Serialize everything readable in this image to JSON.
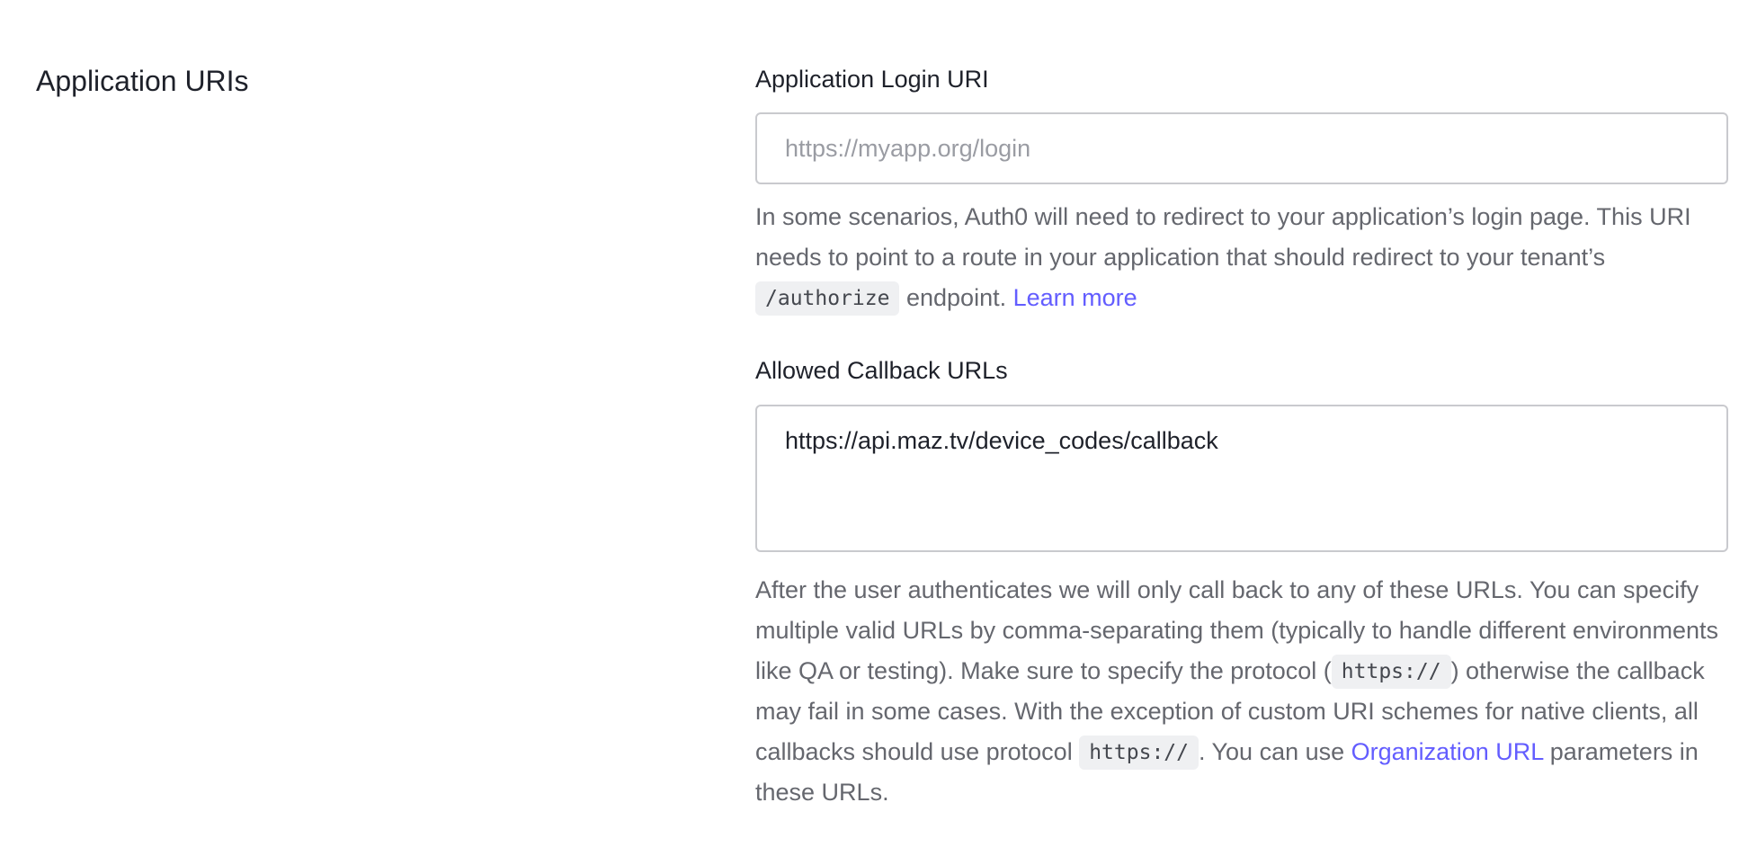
{
  "section": {
    "title": "Application URIs"
  },
  "login_uri": {
    "label": "Application Login URI",
    "value": "",
    "placeholder": "https://myapp.org/login",
    "help_part1": "In some scenarios, Auth0 will need to redirect to your application’s login page. This URI needs to point to a route in your application that should redirect to your tenant’s ",
    "help_code": "/authorize",
    "help_part2": " endpoint. ",
    "help_link": "Learn more"
  },
  "callback_urls": {
    "label": "Allowed Callback URLs",
    "value": "https://api.maz.tv/device_codes/callback",
    "help_part1": "After the user authenticates we will only call back to any of these URLs. You can specify multiple valid URLs by comma-separating them (typically to handle different environments like QA or testing). Make sure to specify the protocol (",
    "help_code1": "https://",
    "help_part2": ") otherwise the callback may fail in some cases. With the exception of custom URI schemes for native clients, all callbacks should use protocol ",
    "help_code2": "https://",
    "help_part3": ". You can use ",
    "help_link": "Organization URL",
    "help_part4": " parameters in these URLs."
  },
  "colors": {
    "link": "#635dff",
    "text": "#1e212a",
    "muted": "#65676e",
    "border": "#c9cace"
  }
}
